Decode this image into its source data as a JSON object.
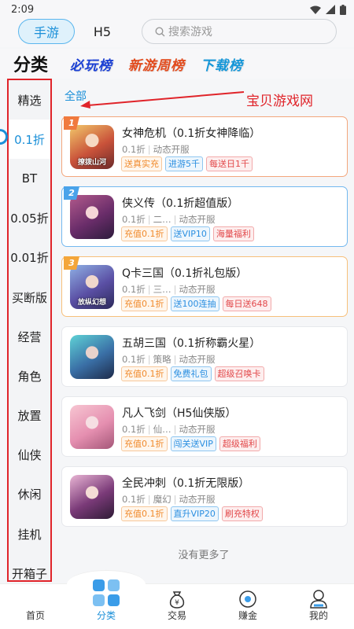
{
  "status_bar": {
    "time": "2:09"
  },
  "top_tabs": [
    {
      "label": "手游",
      "active": true
    },
    {
      "label": "H5",
      "active": false
    }
  ],
  "search": {
    "placeholder": "搜索游戏"
  },
  "category_tabs": {
    "main": "分类",
    "ranks": [
      {
        "label": "必玩榜",
        "color": "#1a3fd4"
      },
      {
        "label": "新游周榜",
        "color": "#e24a1c"
      },
      {
        "label": "下载榜",
        "color": "#1496d8"
      }
    ]
  },
  "sidebar": {
    "items": [
      "精选",
      "0.1折",
      "BT",
      "0.05折",
      "0.01折",
      "买断版",
      "经营",
      "角色",
      "放置",
      "仙侠",
      "休闲",
      "挂机",
      "开箱子"
    ],
    "active_index": 1
  },
  "filter": {
    "all_label": "全部"
  },
  "watermark": "宝贝游戏网",
  "games": [
    {
      "rank": "1",
      "title": "女神危机（0.1折女神降临）",
      "meta": [
        "0.1折",
        "动态开服"
      ],
      "thumb_caption": "撩拨山河",
      "tags": [
        {
          "text": "送真实充",
          "style": "orange"
        },
        {
          "text": "进游5千",
          "style": "blue"
        },
        {
          "text": "每送日1千",
          "style": "red"
        }
      ],
      "border": "c1"
    },
    {
      "rank": "2",
      "title": "侠义传（0.1折超值版）",
      "meta": [
        "0.1折",
        "二…",
        "动态开服"
      ],
      "thumb_caption": "",
      "tags": [
        {
          "text": "充值0.1折",
          "style": "orange"
        },
        {
          "text": "送VIP10",
          "style": "blue"
        },
        {
          "text": "海量福利",
          "style": "red"
        }
      ],
      "border": "c2"
    },
    {
      "rank": "3",
      "title": "Q卡三国（0.1折礼包版）",
      "meta": [
        "0.1折",
        "三…",
        "动态开服"
      ],
      "thumb_caption": "放纵幻想",
      "tags": [
        {
          "text": "充值0.1折",
          "style": "orange"
        },
        {
          "text": "送100连抽",
          "style": "blue"
        },
        {
          "text": "每日送648",
          "style": "red"
        }
      ],
      "border": "c3"
    },
    {
      "rank": "",
      "title": "五胡三国（0.1折称霸火星）",
      "meta": [
        "0.1折",
        "策略",
        "动态开服"
      ],
      "thumb_caption": "",
      "tags": [
        {
          "text": "充值0.1折",
          "style": "orange"
        },
        {
          "text": "免费礼包",
          "style": "blue"
        },
        {
          "text": "超级召唤卡",
          "style": "red"
        }
      ],
      "border": ""
    },
    {
      "rank": "",
      "title": "凡人飞剑（H5仙侠版）",
      "meta": [
        "0.1折",
        "仙…",
        "动态开服"
      ],
      "thumb_caption": "",
      "tags": [
        {
          "text": "充值0.1折",
          "style": "orange"
        },
        {
          "text": "闯关送VIP",
          "style": "blue"
        },
        {
          "text": "超级福利",
          "style": "red"
        }
      ],
      "border": ""
    },
    {
      "rank": "",
      "title": "全民冲刺（0.1折无限版）",
      "meta": [
        "0.1折",
        "魔幻",
        "动态开服"
      ],
      "thumb_caption": "",
      "tags": [
        {
          "text": "充值0.1折",
          "style": "orange"
        },
        {
          "text": "直升VIP20",
          "style": "blue"
        },
        {
          "text": "刷充特权",
          "style": "red"
        }
      ],
      "border": ""
    }
  ],
  "end_text": "没有更多了",
  "bottom_nav": [
    {
      "label": "首页",
      "icon": "home-icon",
      "active": false
    },
    {
      "label": "分类",
      "icon": "category-grid-icon",
      "active": true
    },
    {
      "label": "交易",
      "icon": "money-bag-icon",
      "active": false
    },
    {
      "label": "赚金",
      "icon": "coin-icon",
      "active": false
    },
    {
      "label": "我的",
      "icon": "user-icon",
      "active": false
    }
  ]
}
